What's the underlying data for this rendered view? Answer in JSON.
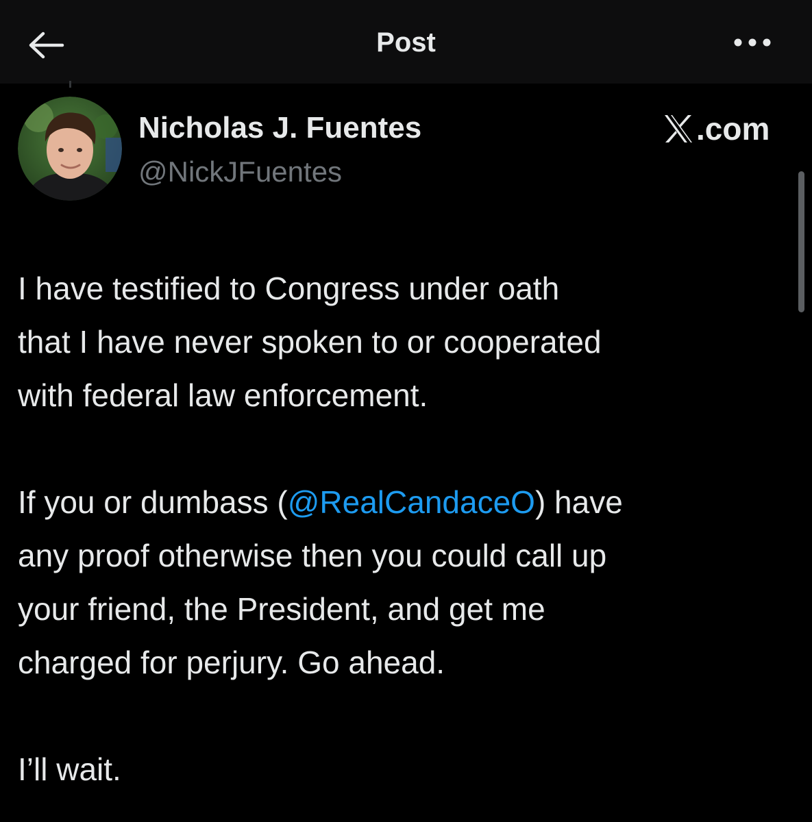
{
  "header": {
    "title": "Post",
    "back_icon": "arrow-left-icon",
    "more_icon": "more-horizontal-icon"
  },
  "author": {
    "name": "Nicholas J. Fuentes",
    "handle": "@NickJFuentes",
    "avatar_icon": "profile-photo"
  },
  "brand": {
    "text": ".com",
    "logo_icon": "x-logo-icon"
  },
  "post": {
    "p1_lines": [
      "I have testified to Congress under oath",
      "that I have never spoken to or cooperated",
      "with federal law enforcement."
    ],
    "p2_line1_before": "If you or dumbass (",
    "p2_mention": "@RealCandaceO",
    "p2_line1_after": ") have",
    "p2_lines": [
      "any proof otherwise then you could call up",
      "your friend, the President, and get me",
      "charged for perjury. Go ahead."
    ],
    "p3": "I’ll wait."
  },
  "colors": {
    "background": "#000000",
    "header_background": "#0d0d0e",
    "text": "#e7e9ea",
    "secondary_text": "#71767b",
    "mention": "#1d9bf0"
  }
}
